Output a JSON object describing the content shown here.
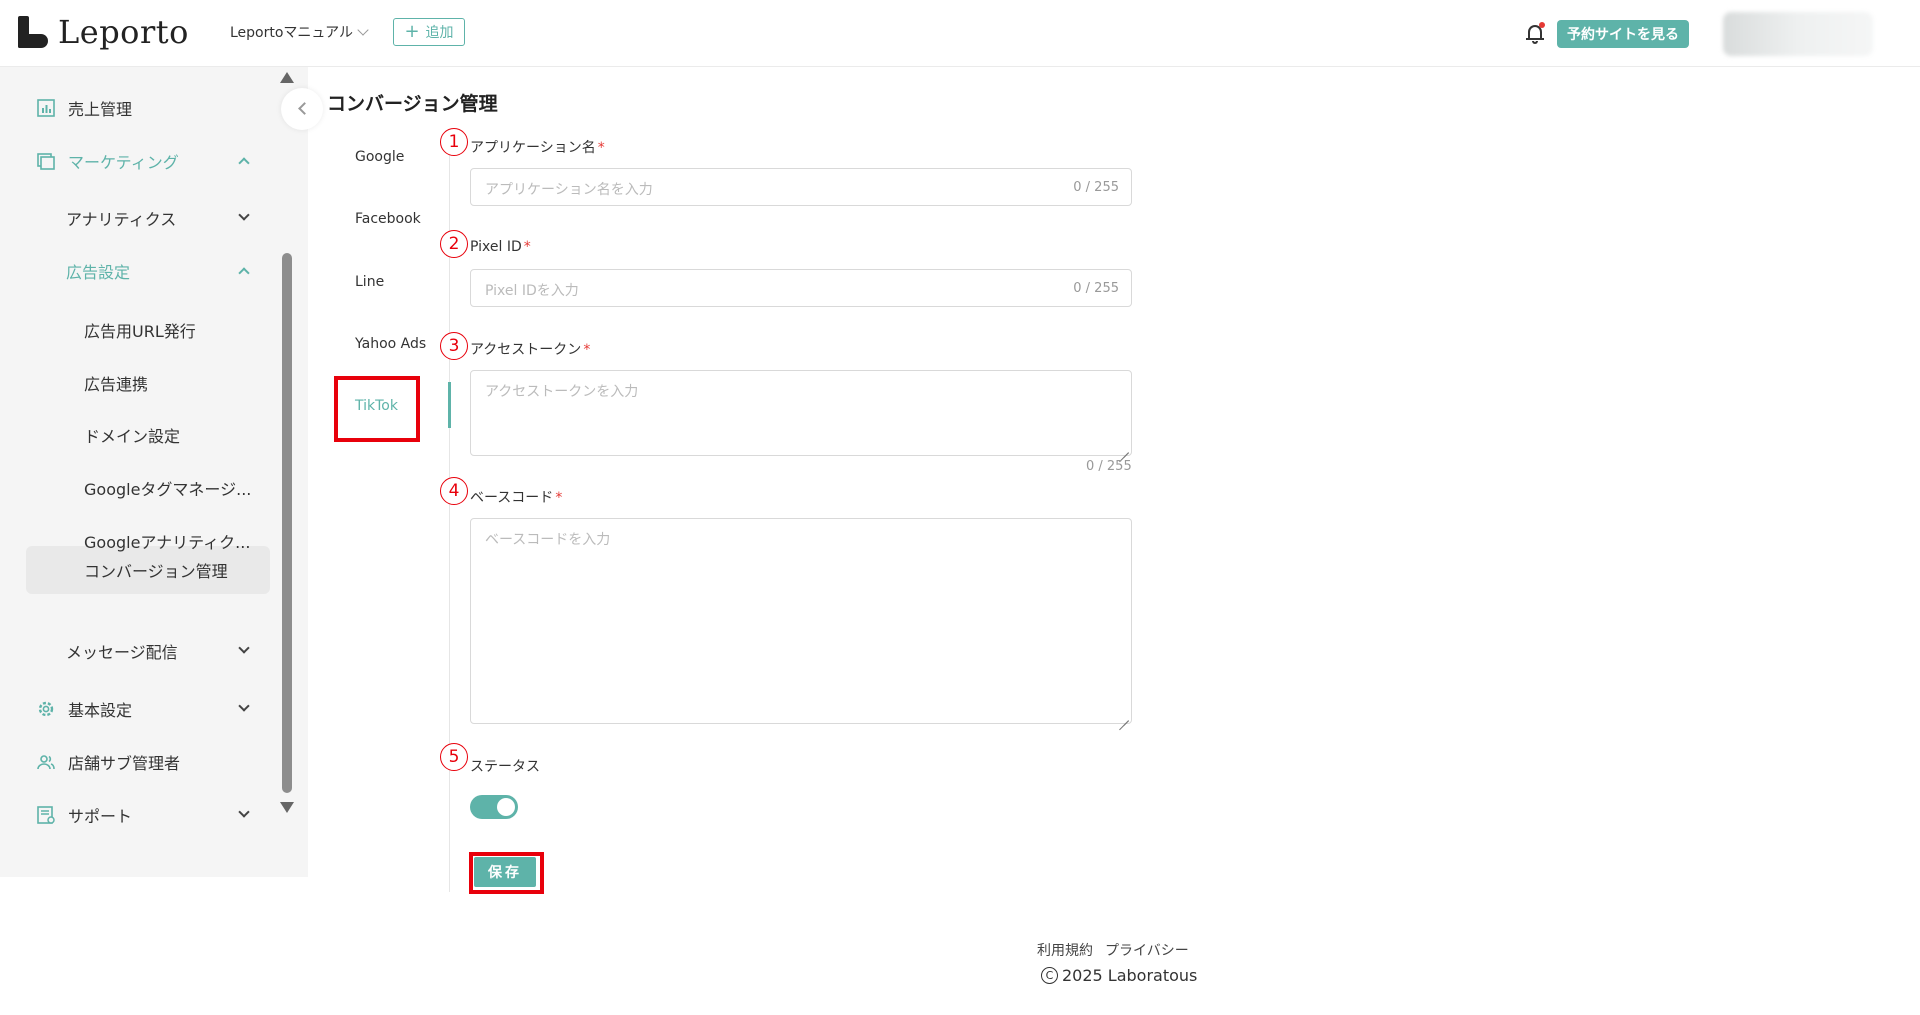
{
  "header": {
    "logo_text": "Leporto",
    "shop_name": "Leportoマニュアル",
    "add_label": "追加",
    "view_site_label": "予約サイトを見る"
  },
  "sidebar": {
    "items": [
      {
        "label": "売上管理"
      },
      {
        "label": "マーケティング"
      },
      {
        "label": "アナリティクス"
      },
      {
        "label": "広告設定"
      },
      {
        "label": "広告用URL発行"
      },
      {
        "label": "広告連携"
      },
      {
        "label": "ドメイン設定"
      },
      {
        "label": "Googleタグマネージ..."
      },
      {
        "label": "Googleアナリティク..."
      },
      {
        "label": "コンバージョン管理"
      },
      {
        "label": "メッセージ配信"
      },
      {
        "label": "基本設定"
      },
      {
        "label": "店舗サブ管理者"
      },
      {
        "label": "サポート"
      }
    ]
  },
  "main": {
    "title": "コンバージョン管理",
    "tabs": [
      {
        "label": "Google"
      },
      {
        "label": "Facebook"
      },
      {
        "label": "Line"
      },
      {
        "label": "Yahoo Ads"
      },
      {
        "label": "TikTok"
      }
    ],
    "active_tab": "TikTok",
    "form": {
      "app_name": {
        "num": "1",
        "label": "アプリケーション名",
        "required": "*",
        "placeholder": "アプリケーション名を入力",
        "count": "0 / 255"
      },
      "pixel_id": {
        "num": "2",
        "label": "Pixel ID",
        "required": "*",
        "placeholder": "Pixel IDを入力",
        "count": "0 / 255"
      },
      "access_token": {
        "num": "3",
        "label": "アクセストークン",
        "required": "*",
        "placeholder": "アクセストークンを入力",
        "count": "0 / 255"
      },
      "base_code": {
        "num": "4",
        "label": "ベースコード",
        "required": "*",
        "placeholder": "ベースコードを入力"
      },
      "status": {
        "num": "5",
        "label": "ステータス",
        "enabled": true
      },
      "save_label": "保存"
    }
  },
  "footer": {
    "terms": "利用規約",
    "privacy": "プライバシー",
    "copyright": "2025 Laboratous"
  },
  "colors": {
    "accent": "#5eb3a9",
    "highlight": "#e8000b"
  }
}
